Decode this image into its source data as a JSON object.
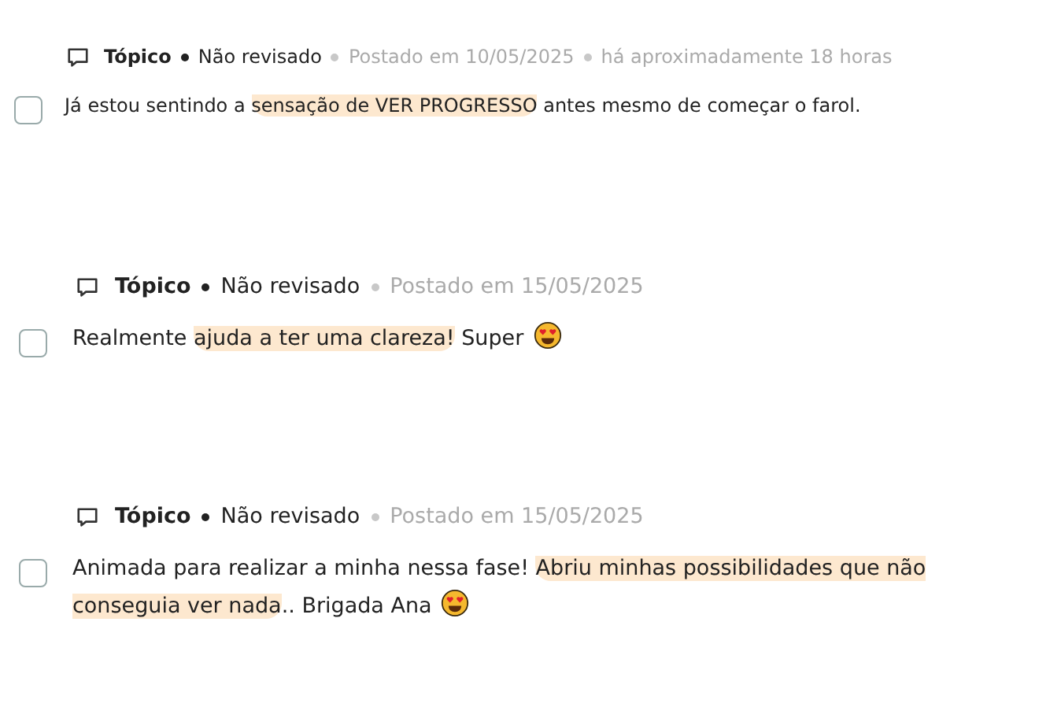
{
  "posts": [
    {
      "type": "Tópico",
      "status": "Não revisado",
      "posted": "Postado em 10/05/2025",
      "ago": "há aproximadamente 18 horas",
      "checked": false,
      "text": [
        {
          "t": "Já estou sentindo a ",
          "highlighted": false
        },
        {
          "t": "sensação de VER PROGRESSO",
          "highlighted": true
        },
        {
          "t": " antes mesmo de começar o farol.",
          "highlighted": false
        }
      ],
      "emoji": false
    },
    {
      "type": "Tópico",
      "status": "Não revisado",
      "posted": "Postado em 15/05/2025",
      "checked": false,
      "text": [
        {
          "t": "Realmente ",
          "highlighted": false
        },
        {
          "t": "ajuda a ter uma clareza!",
          "highlighted": true
        },
        {
          "t": " Super",
          "highlighted": false
        }
      ],
      "emoji": true
    },
    {
      "type": "Tópico",
      "status": "Não revisado",
      "posted": "Postado em 15/05/2025",
      "checked": false,
      "text": [
        {
          "t": "Animada para realizar a minha nessa fase! ",
          "highlighted": false
        },
        {
          "t": "Abriu minhas possibilidades que não conseguia ver nada",
          "highlighted": true
        },
        {
          "t": ".. Brigada Ana",
          "highlighted": false
        }
      ],
      "emoji": true
    }
  ]
}
